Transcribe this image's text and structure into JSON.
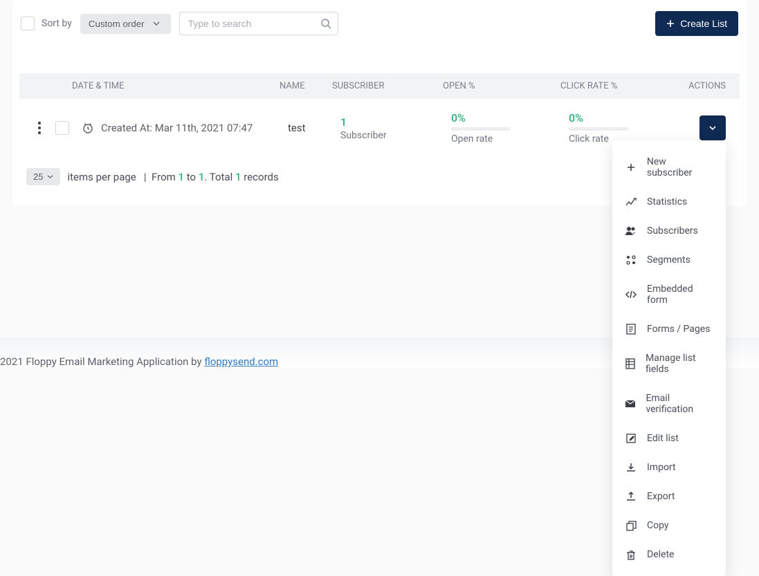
{
  "toolbar": {
    "sort_label": "Sort by",
    "sort_value": "Custom order",
    "search_placeholder": "Type to search",
    "create_label": "Create List"
  },
  "columns": {
    "date": "DATE & TIME",
    "name": "NAME",
    "subscriber": "SUBSCRIBER",
    "open": "OPEN %",
    "click": "CLICK RATE %",
    "actions": "ACTIONS"
  },
  "row": {
    "created": "Created At: Mar 11th, 2021 07:47",
    "name": "test",
    "sub_count": "1",
    "sub_label": "Subscriber",
    "open_val": "0%",
    "open_label": "Open rate",
    "click_val": "0%",
    "click_label": "Click rate"
  },
  "menu": {
    "i0": "New subscriber",
    "i1": "Statistics",
    "i2": "Subscribers",
    "i3": "Segments",
    "i4": "Embedded form",
    "i5": "Forms / Pages",
    "i6": "Manage list fields",
    "i7": "Email verification",
    "i8": "Edit list",
    "i9": "Import",
    "i10": "Export",
    "i11": "Copy",
    "i12": "Delete"
  },
  "pager": {
    "per_page": "25",
    "text_items": "items per page",
    "sep": "|",
    "from_label": "From",
    "from": "1",
    "to_label": "to",
    "to": "1",
    "total_label": ". Total",
    "total": "1",
    "records": "records"
  },
  "footer": {
    "copyright": "2021 Floppy Email Marketing Application by ",
    "link": "floppysend.com"
  }
}
